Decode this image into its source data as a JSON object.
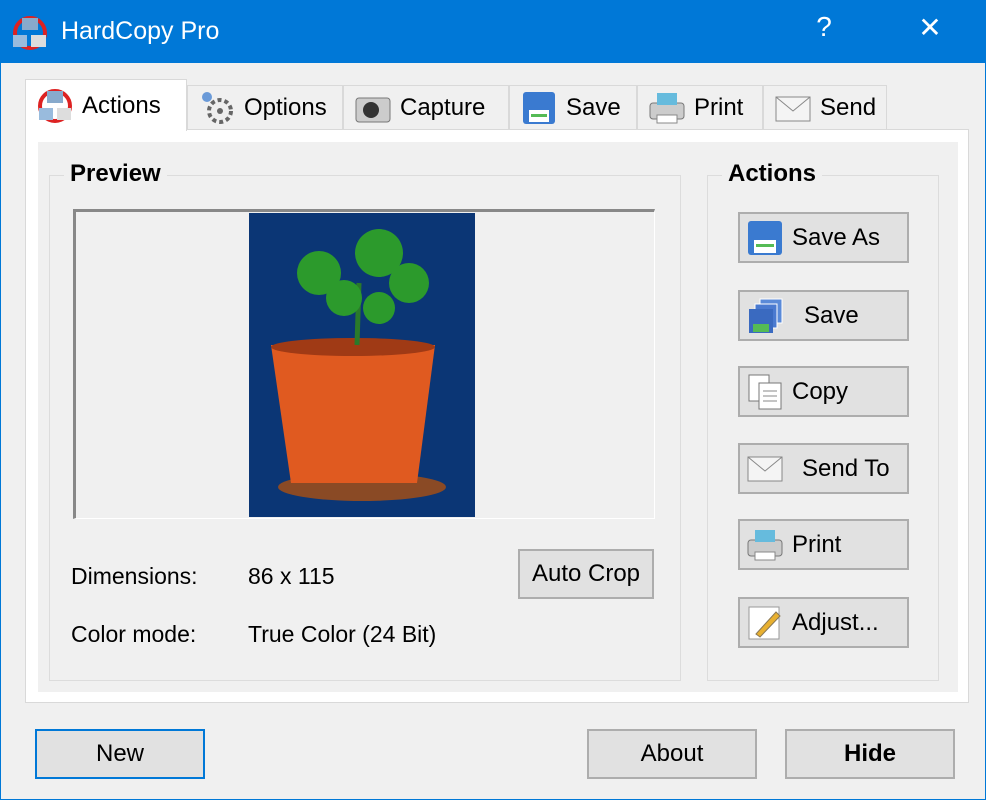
{
  "window": {
    "title": "HardCopy Pro",
    "help": "?",
    "close": "✕"
  },
  "tabs": [
    {
      "label": "Actions",
      "icon": "app-icon"
    },
    {
      "label": "Options",
      "icon": "gear-icon"
    },
    {
      "label": "Capture",
      "icon": "camera-icon"
    },
    {
      "label": "Save",
      "icon": "floppy-icon"
    },
    {
      "label": "Print",
      "icon": "printer-icon"
    },
    {
      "label": "Send",
      "icon": "envelope-icon"
    }
  ],
  "preview": {
    "title": "Preview",
    "dimensions_label": "Dimensions:",
    "dimensions_value": "86 x 115",
    "colormode_label": "Color mode:",
    "colormode_value": "True Color (24 Bit)",
    "autocrop": "Auto Crop"
  },
  "actions": {
    "title": "Actions",
    "buttons": [
      "Save As",
      "Save",
      "Copy",
      "Send To",
      "Print",
      "Adjust..."
    ]
  },
  "footer": {
    "new": "New",
    "about": "About",
    "hide": "Hide"
  }
}
